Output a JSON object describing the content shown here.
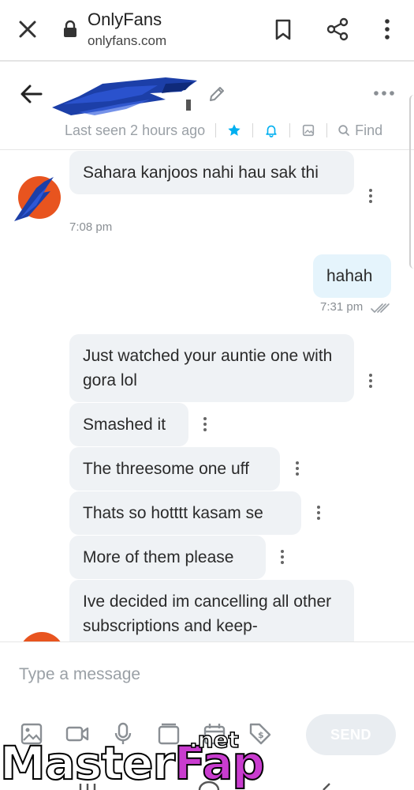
{
  "browser": {
    "title": "OnlyFans",
    "url": "onlyfans.com",
    "icons": [
      "close-icon",
      "lock-icon",
      "bookmark-icon",
      "share-icon",
      "more-vert-icon"
    ]
  },
  "chat_header": {
    "last_seen": "Last seen 2 hours ago",
    "find_label": "Find",
    "icons": [
      "back-arrow-icon",
      "pencil-icon",
      "more-horiz-icon",
      "star-icon",
      "bell-icon",
      "image-icon",
      "search-icon"
    ],
    "accent_color": "#00aff0"
  },
  "messages": [
    {
      "direction": "in",
      "text": "Sahara kanjoos nahi hau sak thi",
      "time": "7:08 pm"
    },
    {
      "direction": "out",
      "text": "hahah",
      "time": "7:31 pm",
      "status": "read"
    },
    {
      "direction": "in",
      "text": "Just watched your auntie one with gora lol"
    },
    {
      "direction": "in",
      "text": "Smashed it"
    },
    {
      "direction": "in",
      "text": "The threesome one uff"
    },
    {
      "direction": "in",
      "text": "Thats so hotttt kasam se"
    },
    {
      "direction": "in",
      "text": "More of them please"
    },
    {
      "direction": "in",
      "text": "Ive decided im cancelling all other subscriptions and keep-"
    }
  ],
  "composer": {
    "placeholder": "Type a message",
    "send_label": "SEND",
    "tools": [
      "image-icon",
      "video-icon",
      "microphone-icon",
      "gallery-icon",
      "calendar-icon",
      "price-tag-icon"
    ]
  },
  "watermark": {
    "brand_a": "Master",
    "brand_b": "Fap",
    "tld": ".net"
  }
}
